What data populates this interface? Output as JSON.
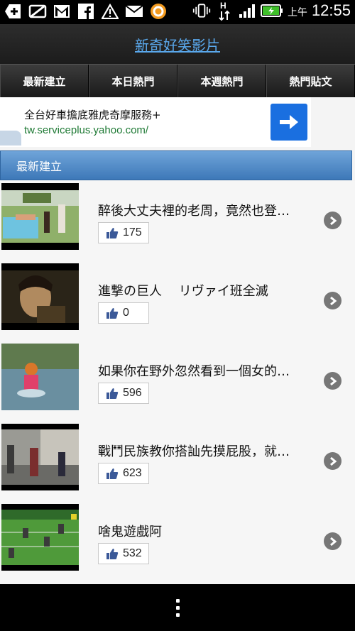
{
  "status_bar": {
    "ampm": "上午",
    "time": "12:55",
    "icons": [
      "add-box-icon",
      "no-sim-icon",
      "gmail-icon",
      "facebook-icon",
      "wifi-alert-icon",
      "mail-icon",
      "app-o-icon",
      "vibrate-icon",
      "data-h-icon",
      "signal-icon",
      "battery-charging-icon"
    ]
  },
  "header": {
    "title": "新奇好笑影片"
  },
  "tabs": [
    {
      "label": "最新建立"
    },
    {
      "label": "本日熱門"
    },
    {
      "label": "本週熱門"
    },
    {
      "label": "熱門貼文"
    }
  ],
  "ad": {
    "title": "全台好車擔底雅虎奇摩服務+",
    "url": "tw.serviceplus.yahoo.com/"
  },
  "section": {
    "title": "最新建立"
  },
  "videos": [
    {
      "title": "醉後大丈夫裡的老周，竟然也登…",
      "likes": "175"
    },
    {
      "title": "進撃の巨人　 リヴァイ班全滅",
      "likes": "0"
    },
    {
      "title": "如果你在野外忽然看到一個女的…",
      "likes": "596"
    },
    {
      "title": "戰鬥民族教你搭訕先摸屁股，就…",
      "likes": "623"
    },
    {
      "title": "啥鬼遊戲阿",
      "likes": "532"
    }
  ],
  "colors": {
    "accent": "#5aa8ec",
    "section_bar": "#4d87c7",
    "ad_button": "#1a6fe0",
    "ad_url": "#1f7a35"
  }
}
